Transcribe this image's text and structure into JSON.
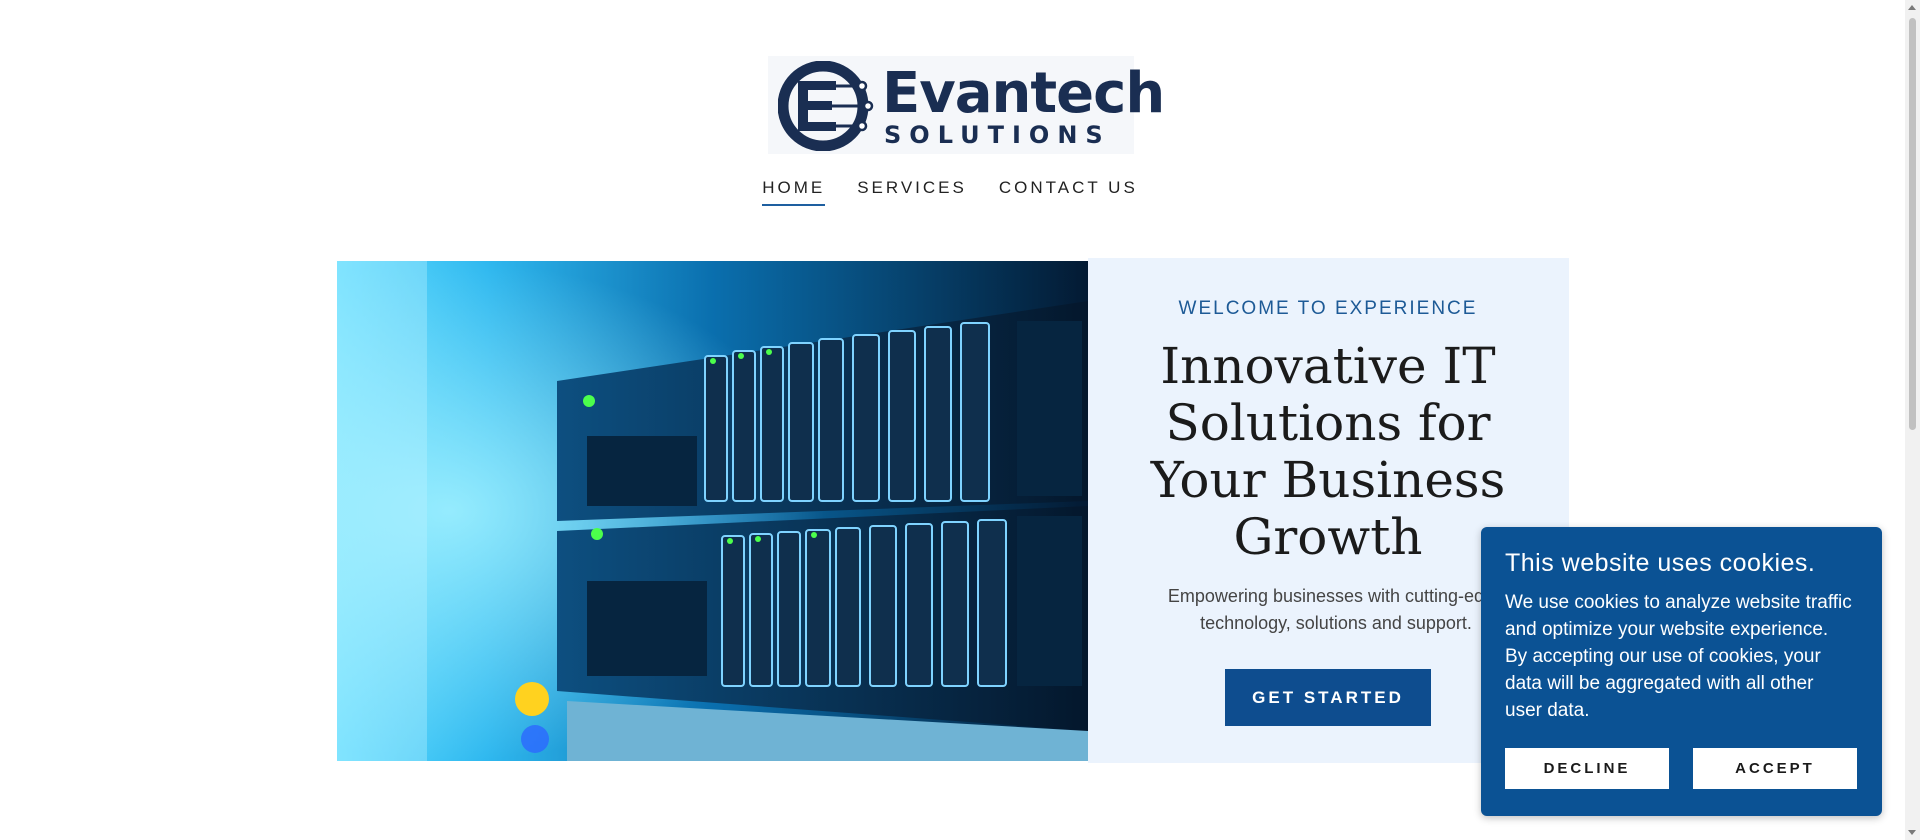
{
  "brand": {
    "name": "Evantech",
    "tagline": "SOLUTIONS",
    "colors": {
      "navy": "#1a2e52",
      "accent": "#0e4d8f",
      "panel": "#ebf3fd"
    }
  },
  "nav": {
    "items": [
      {
        "label": "HOME",
        "active": true
      },
      {
        "label": "SERVICES",
        "active": false
      },
      {
        "label": "CONTACT US",
        "active": false
      }
    ]
  },
  "hero": {
    "image_icon": "server-rack-photo",
    "eyebrow": "WELCOME TO EXPERIENCE",
    "headline": "Innovative IT Solutions for Your Business Growth",
    "subtext_lines": [
      "Empowering businesses with cutting-edge",
      "technology, solutions and support."
    ],
    "cta_label": "GET STARTED"
  },
  "cookie_banner": {
    "title": "This website uses cookies.",
    "body_lines": [
      "We use cookies to analyze website traffic",
      "and optimize your website experience.",
      "By accepting our use of cookies, your",
      "data will be aggregated with all other",
      "user data."
    ],
    "decline_label": "DECLINE",
    "accept_label": "ACCEPT",
    "background": "#0b5294"
  }
}
